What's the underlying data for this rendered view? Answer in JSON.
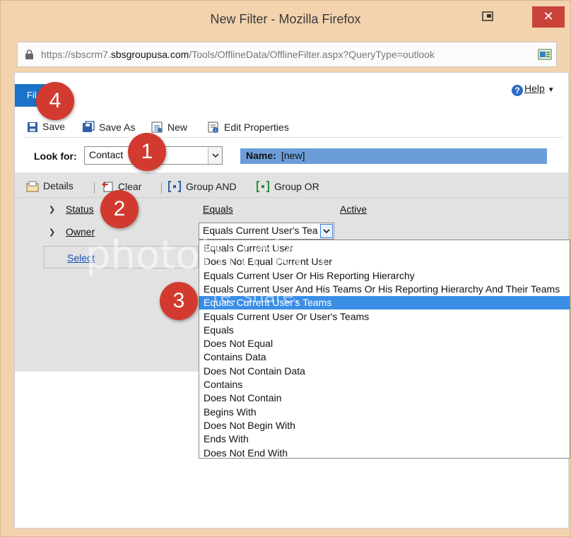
{
  "window": {
    "title": "New Filter - Mozilla Firefox",
    "close_glyph": "✕"
  },
  "urlbar": {
    "prefix": "https://sbscrm7.",
    "domain": "sbsgroupusa.com",
    "path": "/Tools/OfflineData/OfflineFilter.aspx?QueryType=outlook"
  },
  "ribbon": {
    "file_tab": "Fil",
    "help_label": "Help"
  },
  "toolbar": {
    "save": "Save",
    "save_as": "Save As",
    "new": "New",
    "edit_properties": "Edit Properties"
  },
  "lookfor": {
    "label": "Look for:",
    "value": "Contact",
    "name_label": "Name:",
    "name_value": "[new]"
  },
  "filter_toolbar": {
    "details": "Details",
    "clear": "Clear",
    "group_and": "Group AND",
    "group_or": "Group OR"
  },
  "rows": {
    "status_field": "Status",
    "status_operator": "Equals",
    "status_value": "Active",
    "owner_field": "Owner",
    "owner_operator": "Equals Current User's Tea",
    "select_link": "Select"
  },
  "dropdown": {
    "options": [
      "Equals Current User",
      "Does Not Equal Current User",
      "Equals Current User Or His Reporting Hierarchy",
      "Equals Current User And His Teams Or His Reporting Hierarchy And Their Teams",
      "Equals Current User's Teams",
      "Equals Current User Or User's Teams",
      "Equals",
      "Does Not Equal",
      "Contains Data",
      "Does Not Contain Data",
      "Contains",
      "Does Not Contain",
      "Begins With",
      "Does Not Begin With",
      "Ends With",
      "Does Not End With"
    ],
    "selected_index": 4
  },
  "watermark": {
    "line1": "photobucket",
    "line2": "re. share."
  },
  "badges": [
    "4",
    "1",
    "2",
    "3"
  ],
  "colors": {
    "accent": "#1a73c8",
    "selection": "#3a8ee6",
    "name_bar": "#6b9ed9",
    "badge": "#d23a2f",
    "close": "#c9433a"
  }
}
